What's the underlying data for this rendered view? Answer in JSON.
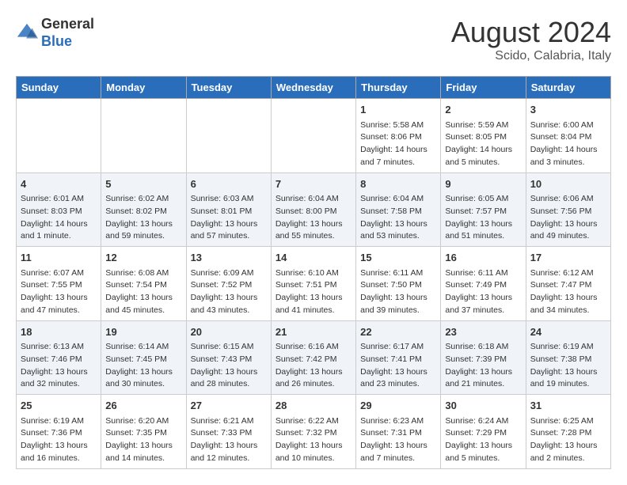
{
  "header": {
    "logo": {
      "general": "General",
      "blue": "Blue"
    },
    "month": "August 2024",
    "location": "Scido, Calabria, Italy"
  },
  "weekdays": [
    "Sunday",
    "Monday",
    "Tuesday",
    "Wednesday",
    "Thursday",
    "Friday",
    "Saturday"
  ],
  "weeks": [
    [
      {
        "day": "",
        "info": ""
      },
      {
        "day": "",
        "info": ""
      },
      {
        "day": "",
        "info": ""
      },
      {
        "day": "",
        "info": ""
      },
      {
        "day": "1",
        "info": "Sunrise: 5:58 AM\nSunset: 8:06 PM\nDaylight: 14 hours and 7 minutes."
      },
      {
        "day": "2",
        "info": "Sunrise: 5:59 AM\nSunset: 8:05 PM\nDaylight: 14 hours and 5 minutes."
      },
      {
        "day": "3",
        "info": "Sunrise: 6:00 AM\nSunset: 8:04 PM\nDaylight: 14 hours and 3 minutes."
      }
    ],
    [
      {
        "day": "4",
        "info": "Sunrise: 6:01 AM\nSunset: 8:03 PM\nDaylight: 14 hours and 1 minute."
      },
      {
        "day": "5",
        "info": "Sunrise: 6:02 AM\nSunset: 8:02 PM\nDaylight: 13 hours and 59 minutes."
      },
      {
        "day": "6",
        "info": "Sunrise: 6:03 AM\nSunset: 8:01 PM\nDaylight: 13 hours and 57 minutes."
      },
      {
        "day": "7",
        "info": "Sunrise: 6:04 AM\nSunset: 8:00 PM\nDaylight: 13 hours and 55 minutes."
      },
      {
        "day": "8",
        "info": "Sunrise: 6:04 AM\nSunset: 7:58 PM\nDaylight: 13 hours and 53 minutes."
      },
      {
        "day": "9",
        "info": "Sunrise: 6:05 AM\nSunset: 7:57 PM\nDaylight: 13 hours and 51 minutes."
      },
      {
        "day": "10",
        "info": "Sunrise: 6:06 AM\nSunset: 7:56 PM\nDaylight: 13 hours and 49 minutes."
      }
    ],
    [
      {
        "day": "11",
        "info": "Sunrise: 6:07 AM\nSunset: 7:55 PM\nDaylight: 13 hours and 47 minutes."
      },
      {
        "day": "12",
        "info": "Sunrise: 6:08 AM\nSunset: 7:54 PM\nDaylight: 13 hours and 45 minutes."
      },
      {
        "day": "13",
        "info": "Sunrise: 6:09 AM\nSunset: 7:52 PM\nDaylight: 13 hours and 43 minutes."
      },
      {
        "day": "14",
        "info": "Sunrise: 6:10 AM\nSunset: 7:51 PM\nDaylight: 13 hours and 41 minutes."
      },
      {
        "day": "15",
        "info": "Sunrise: 6:11 AM\nSunset: 7:50 PM\nDaylight: 13 hours and 39 minutes."
      },
      {
        "day": "16",
        "info": "Sunrise: 6:11 AM\nSunset: 7:49 PM\nDaylight: 13 hours and 37 minutes."
      },
      {
        "day": "17",
        "info": "Sunrise: 6:12 AM\nSunset: 7:47 PM\nDaylight: 13 hours and 34 minutes."
      }
    ],
    [
      {
        "day": "18",
        "info": "Sunrise: 6:13 AM\nSunset: 7:46 PM\nDaylight: 13 hours and 32 minutes."
      },
      {
        "day": "19",
        "info": "Sunrise: 6:14 AM\nSunset: 7:45 PM\nDaylight: 13 hours and 30 minutes."
      },
      {
        "day": "20",
        "info": "Sunrise: 6:15 AM\nSunset: 7:43 PM\nDaylight: 13 hours and 28 minutes."
      },
      {
        "day": "21",
        "info": "Sunrise: 6:16 AM\nSunset: 7:42 PM\nDaylight: 13 hours and 26 minutes."
      },
      {
        "day": "22",
        "info": "Sunrise: 6:17 AM\nSunset: 7:41 PM\nDaylight: 13 hours and 23 minutes."
      },
      {
        "day": "23",
        "info": "Sunrise: 6:18 AM\nSunset: 7:39 PM\nDaylight: 13 hours and 21 minutes."
      },
      {
        "day": "24",
        "info": "Sunrise: 6:19 AM\nSunset: 7:38 PM\nDaylight: 13 hours and 19 minutes."
      }
    ],
    [
      {
        "day": "25",
        "info": "Sunrise: 6:19 AM\nSunset: 7:36 PM\nDaylight: 13 hours and 16 minutes."
      },
      {
        "day": "26",
        "info": "Sunrise: 6:20 AM\nSunset: 7:35 PM\nDaylight: 13 hours and 14 minutes."
      },
      {
        "day": "27",
        "info": "Sunrise: 6:21 AM\nSunset: 7:33 PM\nDaylight: 13 hours and 12 minutes."
      },
      {
        "day": "28",
        "info": "Sunrise: 6:22 AM\nSunset: 7:32 PM\nDaylight: 13 hours and 10 minutes."
      },
      {
        "day": "29",
        "info": "Sunrise: 6:23 AM\nSunset: 7:31 PM\nDaylight: 13 hours and 7 minutes."
      },
      {
        "day": "30",
        "info": "Sunrise: 6:24 AM\nSunset: 7:29 PM\nDaylight: 13 hours and 5 minutes."
      },
      {
        "day": "31",
        "info": "Sunrise: 6:25 AM\nSunset: 7:28 PM\nDaylight: 13 hours and 2 minutes."
      }
    ]
  ]
}
